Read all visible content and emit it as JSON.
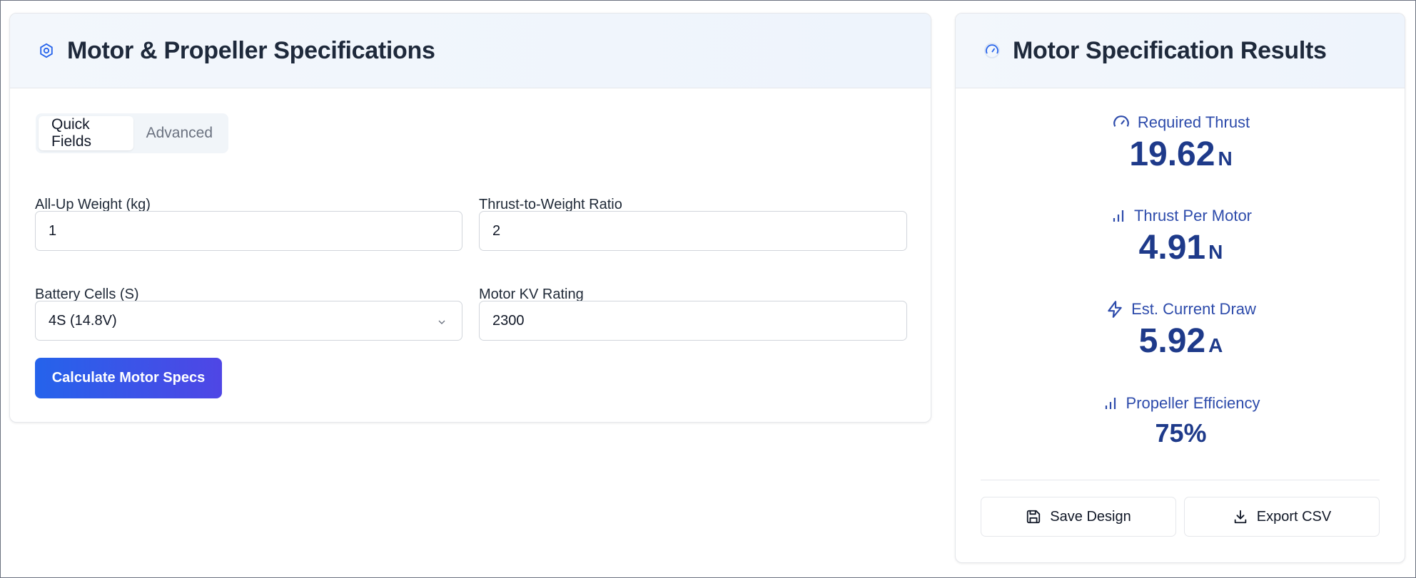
{
  "specs": {
    "title": "Motor & Propeller Specifications",
    "tabs": [
      {
        "label": "Quick Fields",
        "active": true
      },
      {
        "label": "Advanced",
        "active": false
      }
    ],
    "fields": {
      "weight": {
        "label": "All-Up Weight (kg)",
        "value": "1"
      },
      "twr": {
        "label": "Thrust-to-Weight Ratio",
        "value": "2"
      },
      "cells": {
        "label": "Battery Cells (S)",
        "value": "4S (14.8V)"
      },
      "kv": {
        "label": "Motor KV Rating",
        "value": "2300"
      }
    },
    "calculate_label": "Calculate Motor Specs"
  },
  "results": {
    "title": "Motor Specification Results",
    "items": [
      {
        "label": "Required Thrust",
        "value": "19.62",
        "unit": "N",
        "icon": "gauge-icon"
      },
      {
        "label": "Thrust Per Motor",
        "value": "4.91",
        "unit": "N",
        "icon": "bar-chart-icon"
      },
      {
        "label": "Est. Current Draw",
        "value": "5.92",
        "unit": "A",
        "icon": "lightning-icon"
      },
      {
        "label": "Propeller Efficiency",
        "value": "75%",
        "unit": "",
        "icon": "bar-chart-icon"
      }
    ],
    "save_label": "Save Design",
    "export_label": "Export CSV"
  },
  "colors": {
    "accent": "#2563eb",
    "accent_end": "#4f46e5",
    "result_text": "#1e3a8a",
    "result_label": "#2d4bab"
  }
}
